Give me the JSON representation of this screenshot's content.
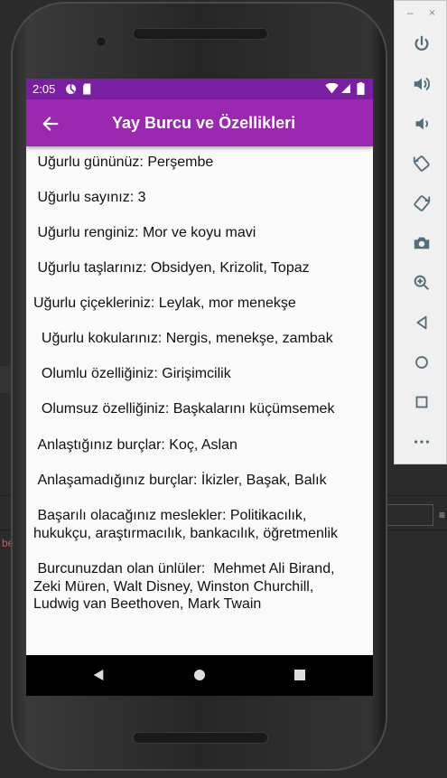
{
  "status_bar": {
    "time": "2:05"
  },
  "app_bar": {
    "title": "Yay Burcu ve Özellikleri"
  },
  "content": {
    "lines": [
      " Uğurlu gününüz: Perşembe",
      " Uğurlu sayınız: 3",
      " Uğurlu renginiz: Mor ve koyu mavi",
      " Uğurlu taşlarınız: Obsidyen, Krizolit, Topaz",
      "Uğurlu çiçekleriniz: Leylak, mor menekşe",
      "  Uğurlu kokularınız: Nergis, menekşe, zambak",
      "  Olumlu özelliğiniz: Girişimcilik",
      "  Olumsuz özelliğiniz: Başkalarını küçümsemek",
      " Anlaştığınız burçlar: Koç, Aslan",
      " Anlaşamadığınız burçlar: İkizler, Başak, Balık",
      " Başarılı olacağınız meslekler: Politikacılık,\nhukukçu, araştırmacılık, bankacılık, öğretmenlik",
      " Burcunuzdan olan ünlüler:  Mehmet Ali Birand,\nZeki Müren, Walt Disney, Winston Churchill,\nLudwig van Beethoven, Mark Twain"
    ]
  },
  "ide_background": {
    "error_fragment": "be"
  },
  "emulator_panel": {
    "window_controls": [
      "–",
      "×"
    ],
    "buttons": [
      "power-icon",
      "volume-up-icon",
      "volume-down-icon",
      "rotate-left-icon",
      "rotate-right-icon",
      "camera-icon",
      "zoom-icon",
      "back-icon",
      "home-icon",
      "overview-icon",
      "more-icon"
    ]
  },
  "colors": {
    "status_bar": "#7b1fa2",
    "app_bar": "#9c27b0",
    "emulator_icon": "#546e7a"
  }
}
